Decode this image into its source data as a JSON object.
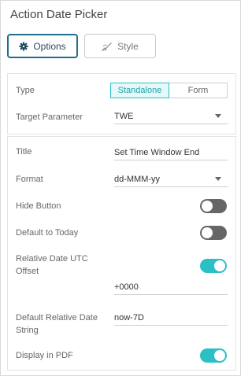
{
  "panel": {
    "title": "Action Date Picker"
  },
  "tabs": [
    {
      "label": "Options",
      "icon": "gear-icon",
      "active": true
    },
    {
      "label": "Style",
      "icon": "brush-icon",
      "active": false
    }
  ],
  "type_row": {
    "label": "Type",
    "options": [
      "Standalone",
      "Form"
    ],
    "selected": "Standalone"
  },
  "target_parameter": {
    "label": "Target Parameter",
    "value": "TWE"
  },
  "title_field": {
    "label": "Title",
    "value": "Set Time Window End"
  },
  "format_field": {
    "label": "Format",
    "value": "dd-MMM-yy"
  },
  "hide_button": {
    "label": "Hide Button",
    "on": false
  },
  "default_today": {
    "label": "Default to Today",
    "on": false
  },
  "relative_utc": {
    "label_line1": "Relative Date UTC",
    "label_line2": "Offset",
    "on": true,
    "value": "+0000"
  },
  "default_relative": {
    "label_line1": "Default Relative Date",
    "label_line2": "String",
    "value": "now-7D"
  },
  "display_pdf": {
    "label": "Display in PDF",
    "on": true
  },
  "colors": {
    "accent": "#2bbfc6",
    "tab_border": "#1f6e8c",
    "toggle_off": "#666666"
  }
}
